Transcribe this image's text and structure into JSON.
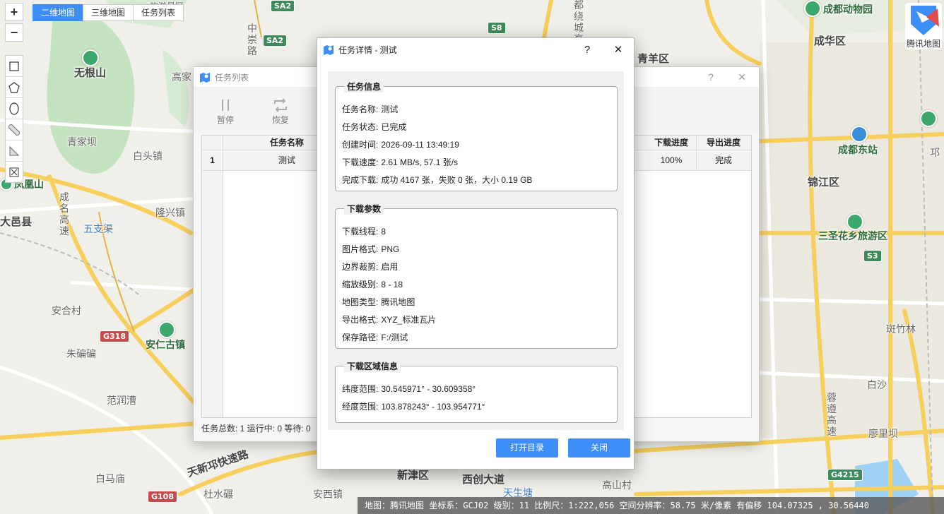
{
  "map": {
    "labels": [
      {
        "text": "无根山",
        "cls": "bold"
      },
      {
        "text": "青家坝",
        "cls": ""
      },
      {
        "text": "白头镇",
        "cls": ""
      },
      {
        "text": "凤凰山",
        "cls": "green"
      },
      {
        "text": "大邑县",
        "cls": "bold"
      },
      {
        "text": "五支渠",
        "cls": "blue"
      },
      {
        "text": "隆兴镇",
        "cls": ""
      },
      {
        "text": "安合村",
        "cls": ""
      },
      {
        "text": "安仁古镇",
        "cls": "green"
      },
      {
        "text": "朱碥碥",
        "cls": ""
      },
      {
        "text": "范润漕",
        "cls": ""
      },
      {
        "text": "白马庙",
        "cls": ""
      },
      {
        "text": "天新邛快速路",
        "cls": "bold"
      },
      {
        "text": "杜水碾",
        "cls": ""
      },
      {
        "text": "安西镇",
        "cls": ""
      },
      {
        "text": "新津区",
        "cls": "bold"
      },
      {
        "text": "西创大道",
        "cls": "bold"
      },
      {
        "text": "高山村",
        "cls": ""
      },
      {
        "text": "天生塘",
        "cls": "blue"
      },
      {
        "text": "高家",
        "cls": ""
      },
      {
        "text": "成都动物园",
        "cls": "green"
      },
      {
        "text": "成华区",
        "cls": "bold"
      },
      {
        "text": "青羊区",
        "cls": "bold"
      },
      {
        "text": "成都东站",
        "cls": "green"
      },
      {
        "text": "锦江区",
        "cls": "bold"
      },
      {
        "text": "三圣花乡旅游区",
        "cls": "green"
      },
      {
        "text": "斑竹林",
        "cls": ""
      },
      {
        "text": "白沙",
        "cls": ""
      },
      {
        "text": "廖里坝",
        "cls": ""
      },
      {
        "text": "中崇路",
        "cls": ""
      },
      {
        "text": "都绕城高",
        "cls": ""
      },
      {
        "text": "成名高速",
        "cls": ""
      },
      {
        "text": "蓉遵高速",
        "cls": ""
      },
      {
        "text": "邛",
        "cls": ""
      },
      {
        "text": "旅游景区",
        "cls": ""
      }
    ],
    "shields": [
      {
        "text": "SA2",
        "cls": "green"
      },
      {
        "text": "SA2",
        "cls": "green"
      },
      {
        "text": "S8",
        "cls": "green"
      },
      {
        "text": "G318",
        "cls": "red"
      },
      {
        "text": "G108",
        "cls": "red"
      },
      {
        "text": "S3",
        "cls": "green"
      },
      {
        "text": "G4215",
        "cls": "green"
      }
    ]
  },
  "controls": {
    "zoom_in": "+",
    "zoom_out": "−",
    "tabs": [
      {
        "label": "二维地图",
        "active": true
      },
      {
        "label": "三维地图",
        "active": false
      },
      {
        "label": "任务列表",
        "active": false
      }
    ],
    "logo_text": "腾讯地图"
  },
  "statusbar": "地图：腾讯地图  坐标系：GCJ02  级别：11  比例尺：1:222,056  空间分辨率：58.75 米/像素  有偏移  104.07325 , 30.56440",
  "task_window": {
    "title": "任务列表",
    "help": "?",
    "close": "✕",
    "toolbar": {
      "pause": "暂停",
      "resume": "恢复"
    },
    "columns": {
      "name": "任务名称",
      "download_progress": "下载进度",
      "export_progress": "导出进度"
    },
    "row": {
      "index": "1",
      "name": "测试",
      "download_progress": "100%",
      "export_progress": "完成"
    },
    "footer": "任务总数: 1  运行中: 0  等待: 0"
  },
  "dialog": {
    "title": "任务详情 - 测试",
    "help": "?",
    "close": "✕",
    "groups": {
      "task_info": {
        "title": "任务信息",
        "items": [
          {
            "k": "任务名称:",
            "v": "测试"
          },
          {
            "k": "任务状态:",
            "v": "已完成"
          },
          {
            "k": "创建时间:",
            "v": "2026-09-11 13:49:19"
          },
          {
            "k": "下载速度:",
            "v": "2.61 MB/s, 57.1 张/s"
          },
          {
            "k": "完成下载:",
            "v": "成功 4167 张，失败 0 张，大小 0.19 GB"
          }
        ]
      },
      "download_params": {
        "title": "下载参数",
        "items": [
          {
            "k": "下载线程:",
            "v": "8"
          },
          {
            "k": "图片格式:",
            "v": "PNG"
          },
          {
            "k": "边界裁剪:",
            "v": "启用"
          },
          {
            "k": "缩放级别:",
            "v": "8 - 18"
          },
          {
            "k": "地图类型:",
            "v": "腾讯地图"
          },
          {
            "k": "导出格式:",
            "v": "XYZ_标准瓦片"
          },
          {
            "k": "保存路径:",
            "v": "F:/测试"
          }
        ]
      },
      "area_info": {
        "title": "下载区域信息",
        "items": [
          {
            "k": "纬度范围:",
            "v": "30.545971° - 30.609358°"
          },
          {
            "k": "经度范围:",
            "v": "103.878243° - 103.954771°"
          }
        ]
      }
    },
    "buttons": {
      "open_dir": "打开目录",
      "close": "关闭"
    }
  },
  "colors": {
    "accent": "#3e8ef7",
    "park": "#c4e3c0",
    "road_yellow": "#f7cf5c",
    "water": "#9fd1f5"
  }
}
